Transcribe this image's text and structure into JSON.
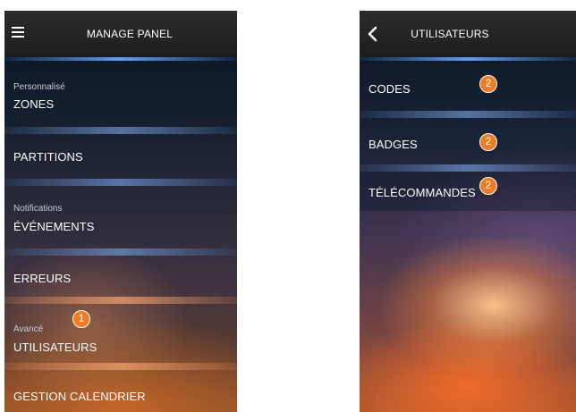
{
  "left_screen": {
    "title": "MANAGE PANEL",
    "menu_icon": "hamburger-menu-icon",
    "items": [
      {
        "sub": "Personnalisé",
        "label": "ZONES"
      },
      {
        "sub": "",
        "label": "PARTITIONS"
      },
      {
        "sub": "Notifications",
        "label": "ÉVÉNEMENTS"
      },
      {
        "sub": "",
        "label": "ERREURS"
      },
      {
        "sub": "Avancé",
        "label": "UTILISATEURS"
      },
      {
        "sub": "",
        "label": "GESTION CALENDRIER"
      }
    ],
    "callout": "1"
  },
  "right_screen": {
    "title": "UTILISATEURS",
    "back_icon": "chevron-left-icon",
    "items": [
      {
        "label": "CODES",
        "callout": "2"
      },
      {
        "label": "BADGES",
        "callout": "2"
      },
      {
        "label": "TÉLÉCOMMANDES",
        "callout": "2"
      }
    ]
  },
  "colors": {
    "callout": "#ef7b22",
    "topbar": "#2c2c2c",
    "text": "#ffffff"
  }
}
